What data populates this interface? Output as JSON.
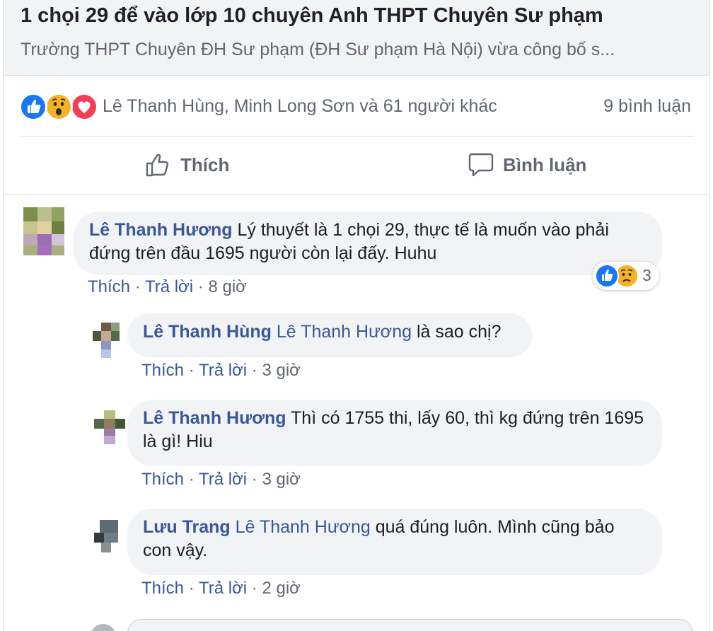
{
  "link_preview": {
    "title": "1 chọi 29 để vào lớp 10 chuyên Anh THPT Chuyên Sư phạm",
    "description": "Trường THPT Chuyên ĐH Sư phạm (ĐH Sư phạm Hà Nội) vừa công bố s..."
  },
  "stats": {
    "reaction_icons": [
      "like-icon",
      "wow-icon",
      "love-icon"
    ],
    "reactors_text": "Lê Thanh Hùng, Minh Long Sơn và 61 người khác",
    "comment_count": "9 bình luận"
  },
  "actions": {
    "like_label": "Thích",
    "comment_label": "Bình luận"
  },
  "comments": [
    {
      "author": "Lê Thanh Hương",
      "text": "Lý thuyết là 1 chọi 29, thực tế là muốn vào phải đứng trên đầu 1695 người còn lại đấy. Huhu",
      "like": "Thích",
      "reply": "Trả lời",
      "time": "8 giờ",
      "reaction_count": "3",
      "reaction_icons": [
        "like-icon",
        "sad-icon"
      ]
    }
  ],
  "replies": [
    {
      "author": "Lê Thanh Hùng",
      "tag": "Lê Thanh Hương",
      "text": "là sao chị?",
      "like": "Thích",
      "reply": "Trả lời",
      "time": "3 giờ"
    },
    {
      "author": "Lê Thanh Hương",
      "tag": "",
      "text": "Thì có 1755 thi, lấy 60, thì kg đứng trên 1695 là gì! Hiu",
      "like": "Thích",
      "reply": "Trả lời",
      "time": "3 giờ"
    },
    {
      "author": "Lưu Trang",
      "tag": "Lê Thanh Hương",
      "text": "quá đúng luôn. Mình cũng bảo con vậy.",
      "like": "Thích",
      "reply": "Trả lời",
      "time": "2 giờ"
    }
  ],
  "separator": " · ",
  "colors": {
    "link_blue": "#385898",
    "like_blue": "#1877f2",
    "love_red": "#f33e58",
    "wow_yellow": "#f7b125",
    "bubble_gray": "#f2f3f5",
    "meta_gray": "#606770"
  }
}
